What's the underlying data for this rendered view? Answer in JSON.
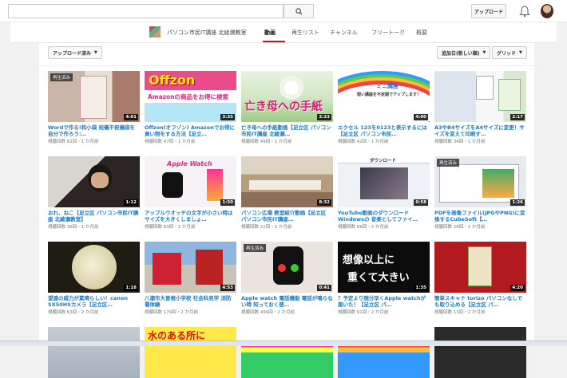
{
  "header": {
    "search_placeholder": "",
    "upload_label": "アップロード"
  },
  "channel": {
    "name": "パソコン市民IT講座 北綾瀬教室",
    "tabs": [
      "動画",
      "再生リスト",
      "チャンネル",
      "フリートーク",
      "概要"
    ]
  },
  "toolbar": {
    "uploads_label": "アップロード済み",
    "sort_label": "追加日(新しい順)",
    "view_label": "グリッド"
  },
  "videos": [
    {
      "title": "Wordで作る!和小袋 祝儀不祝儀袋を自分で作ろう:…",
      "meta": "視聴回数 62回・1 か月前",
      "duration": "4:01",
      "watched": "再生済み"
    },
    {
      "title": "Offzon(オフゾン) Amazonでお得に買い物をする方法【足立…",
      "meta": "視聴回数 47回・1 か月前",
      "duration": "3:35",
      "watched": ""
    },
    {
      "title": "亡き母への手紙動画【足立区 パソコン市民IT講座 北綾瀬…",
      "meta": "視聴回数 49回・1 か月前",
      "duration": "2:23",
      "watched": ""
    },
    {
      "title": "エクセル 123を0123と表示するには【足立区 パソコン市民…",
      "meta": "視聴回数 42回・1 か月前",
      "duration": "4:00",
      "watched": ""
    },
    {
      "title": "A3やB4サイズをA4サイズに変更！サイズを変えて印刷す…",
      "meta": "視聴回数 34回・1 か月前",
      "duration": "2:17",
      "watched": ""
    },
    {
      "title": "おれ、ねこ【足立区 パソコン市民IT講座 北綾瀬教室】",
      "meta": "視聴回数 36回・1 か月前",
      "duration": "1:12",
      "watched": ""
    },
    {
      "title": "アップルウオッチの文字が小さい時はサイズを大きくしましょ…",
      "meta": "視聴回数 83回・1 か月前",
      "duration": "1:50",
      "watched": ""
    },
    {
      "title": "パソコン広場 教室紹介動画【足立区 パソコン市民IT講座…",
      "meta": "視聴回数 22回・2 か月前",
      "duration": "8:32",
      "watched": ""
    },
    {
      "title": "YouTube動画のダウンロード Windowsの 音楽としてファイ…",
      "meta": "視聴回数 66回・2 か月前",
      "duration": "0:58",
      "watched": ""
    },
    {
      "title": "PDFを画像ファイル(JPGやPNG)に変換するCubeSoft【…",
      "meta": "視聴回数 28回・2 か月前",
      "duration": "1:26",
      "watched": "再生済み"
    },
    {
      "title": "望遠の威力が素晴らしい！canon SX50HSカメラ【足立区…",
      "meta": "視聴回数 63回・2 か月前",
      "duration": "1:18",
      "watched": ""
    },
    {
      "title": "八潮市大曽根小学校 社会科見学 消防署体験",
      "meta": "視聴回数 179回・2 か月前",
      "duration": "4:53",
      "watched": ""
    },
    {
      "title": "Apple watch 電話機能 電話が鳴らない時 知っておく便…",
      "meta": "視聴回数 499回・2 か月前",
      "duration": "0:41",
      "watched": "再生済み"
    },
    {
      "title": "？予定より随分早くApple watchが届いた！【足立区 パ…",
      "meta": "視聴回数 91回・2 か月前",
      "duration": "1:35",
      "watched": ""
    },
    {
      "title": "簡単スキャナ torizo パソコンなしでも取り込める【足立区 パ…",
      "meta": "視聴回数 13回・2 か月前",
      "duration": "4:20",
      "watched": ""
    }
  ],
  "thumb_texts": {
    "offzon": "Offzon",
    "amazon": "Amazonの商品をお得に検索",
    "letter": "亡き母への手紙",
    "mini": "ミニ講座",
    "mini_sub": "短い講座を不定期でアップします！",
    "apple_watch": "Apple Watch",
    "download": "ダウンロード",
    "souzou1": "想像以上に",
    "souzou2": "重くて大きい",
    "row4": "水のある所に"
  }
}
